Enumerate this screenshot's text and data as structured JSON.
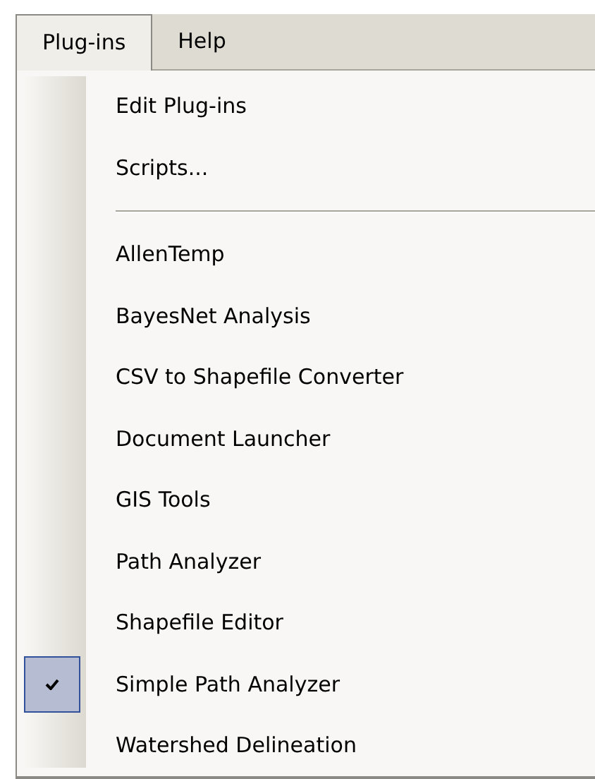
{
  "menubar": [
    {
      "label": "Plug-ins",
      "selected": true
    },
    {
      "label": "Help",
      "selected": false
    }
  ],
  "menu": [
    {
      "kind": "item",
      "label": "Edit Plug-ins",
      "checked": false
    },
    {
      "kind": "item",
      "label": "Scripts...",
      "checked": false
    },
    {
      "kind": "separator"
    },
    {
      "kind": "item",
      "label": "AllenTemp",
      "checked": false
    },
    {
      "kind": "item",
      "label": "BayesNet Analysis",
      "checked": false
    },
    {
      "kind": "item",
      "label": "CSV to Shapefile Converter",
      "checked": false
    },
    {
      "kind": "item",
      "label": "Document Launcher",
      "checked": false
    },
    {
      "kind": "item",
      "label": "GIS Tools",
      "checked": false
    },
    {
      "kind": "item",
      "label": "Path Analyzer",
      "checked": false
    },
    {
      "kind": "item",
      "label": "Shapefile Editor",
      "checked": false
    },
    {
      "kind": "item",
      "label": "Simple Path Analyzer",
      "checked": true
    },
    {
      "kind": "item",
      "label": "Watershed Delineation",
      "checked": false
    }
  ]
}
